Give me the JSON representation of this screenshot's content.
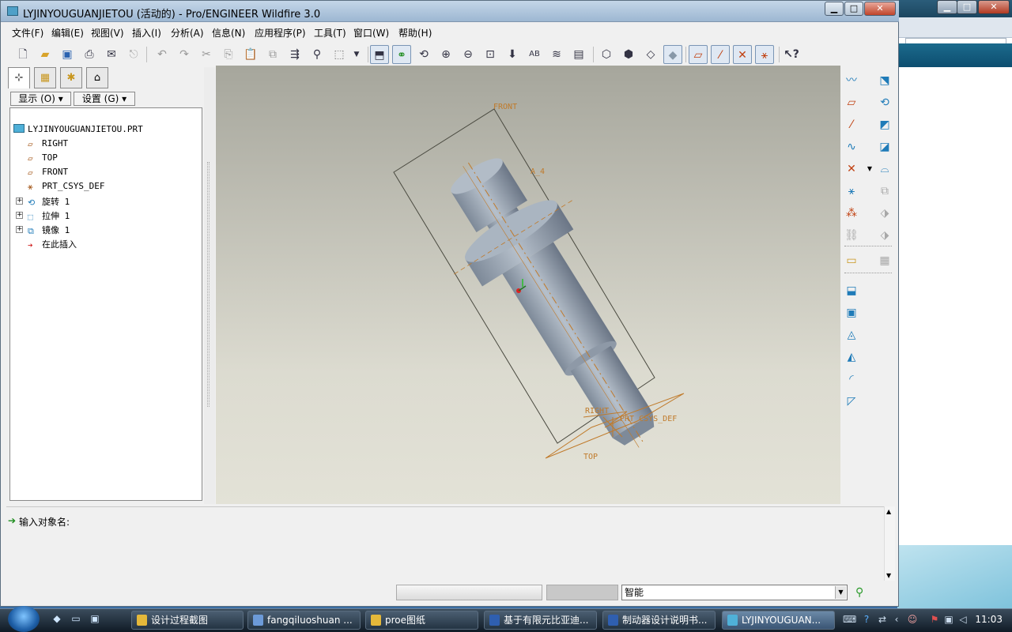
{
  "window": {
    "title": "LYJINYOUGUANJIETOU (活动的) - Pro/ENGINEER Wildfire 3.0",
    "controls": {
      "minimize": "▁",
      "maximize": "□",
      "close": "✕"
    }
  },
  "menubar": [
    "文件(F)",
    "编辑(E)",
    "视图(V)",
    "插入(I)",
    "分析(A)",
    "信息(N)",
    "应用程序(P)",
    "工具(T)",
    "窗口(W)",
    "帮助(H)"
  ],
  "nav": {
    "show_button": "显示 (O) ▾",
    "settings_button": "设置 (G) ▾"
  },
  "tree": {
    "root": "LYJINYOUGUANJIETOU.PRT",
    "items": [
      "RIGHT",
      "TOP",
      "FRONT",
      "PRT_CSYS_DEF",
      "旋转 1",
      "拉伸 1",
      "镜像 1",
      "在此插入"
    ]
  },
  "viewport": {
    "labels": {
      "front": "FRONT",
      "a4": "A_4",
      "right": "RIGHT",
      "csys": "PRT_CSYS_DEF",
      "top": "TOP"
    }
  },
  "message": {
    "prompt": "输入对象名:"
  },
  "status": {
    "filter_value": "智能"
  },
  "taskbar": {
    "buttons": [
      "设计过程截图",
      "fangqiluoshuan ...",
      "proe图纸",
      "基于有限元比亚迪...",
      "制动器设计说明书...",
      "LYJINYOUGUAN..."
    ],
    "clock": "11:03"
  },
  "colors": {
    "datum": "#c07a2a",
    "viewport_top": "#a6a69c",
    "viewport_bottom": "#e3e2d7",
    "part": "#9aa6b4"
  }
}
